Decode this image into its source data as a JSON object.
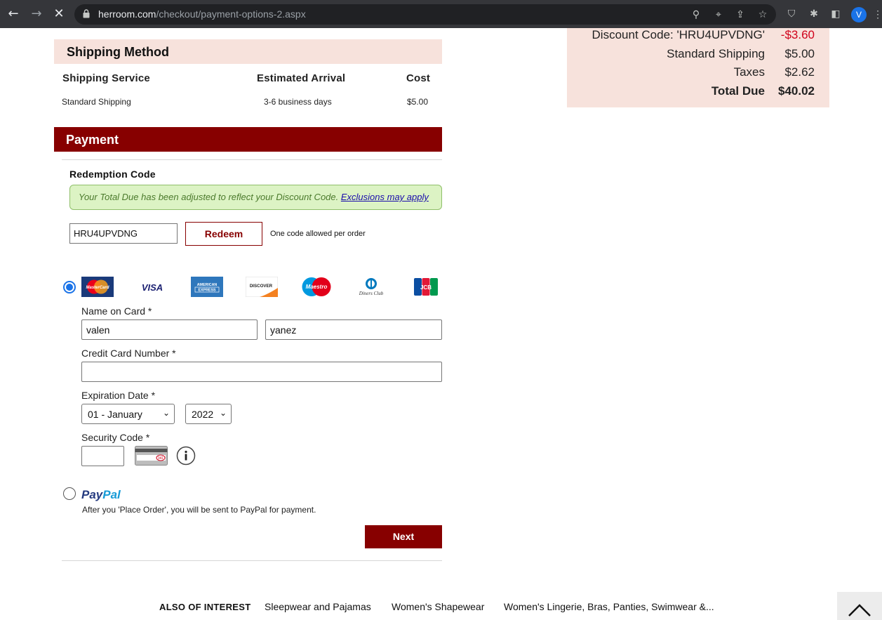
{
  "browser": {
    "url_host": "herroom.com",
    "url_path": "/checkout/payment-options-2.aspx",
    "profile_initial": "V"
  },
  "summary": {
    "discount_label": "Discount Code: 'HRU4UPVDNG'",
    "discount_value": "-$3.60",
    "shipping_label": "Standard Shipping",
    "shipping_value": "$5.00",
    "taxes_label": "Taxes",
    "taxes_value": "$2.62",
    "total_label": "Total Due",
    "total_value": "$40.02"
  },
  "shipping": {
    "title": "Shipping Method",
    "headers": [
      "Shipping Service",
      "Estimated Arrival",
      "Cost"
    ],
    "row": [
      "Standard Shipping",
      "3-6 business days",
      "$5.00"
    ]
  },
  "payment": {
    "title": "Payment",
    "redemption_title": "Redemption Code",
    "notice_text": "Your Total Due has been adjusted to reflect your Discount Code.",
    "notice_link": "Exclusions may apply",
    "code_value": "HRU4UPVDNG",
    "redeem_label": "Redeem",
    "one_code_note": "One code allowed per order",
    "cards": [
      "MasterCard",
      "VISA",
      "AMERICAN EXPRESS",
      "DISCOVER",
      "Maestro",
      "Diners Club",
      "JCB"
    ],
    "name_label": "Name on Card *",
    "first_name": "valen",
    "last_name": "yanez",
    "cc_label": "Credit Card Number *",
    "cc_value": "",
    "exp_label": "Expiration Date *",
    "exp_month": "01 - January",
    "exp_year": "2022",
    "cvv_label": "Security Code *",
    "cvv_value": "",
    "cvv_sample": "341",
    "paypal_pay": "Pay",
    "paypal_pal": "Pal",
    "paypal_note": "After you 'Place Order', you will be sent to PayPal for payment.",
    "next_label": "Next"
  },
  "also": {
    "title": "ALSO OF INTEREST",
    "links": [
      "Sleepwear and Pajamas",
      "Women's Shapewear",
      "Women's Lingerie, Bras, Panties, Swimwear &..."
    ]
  }
}
